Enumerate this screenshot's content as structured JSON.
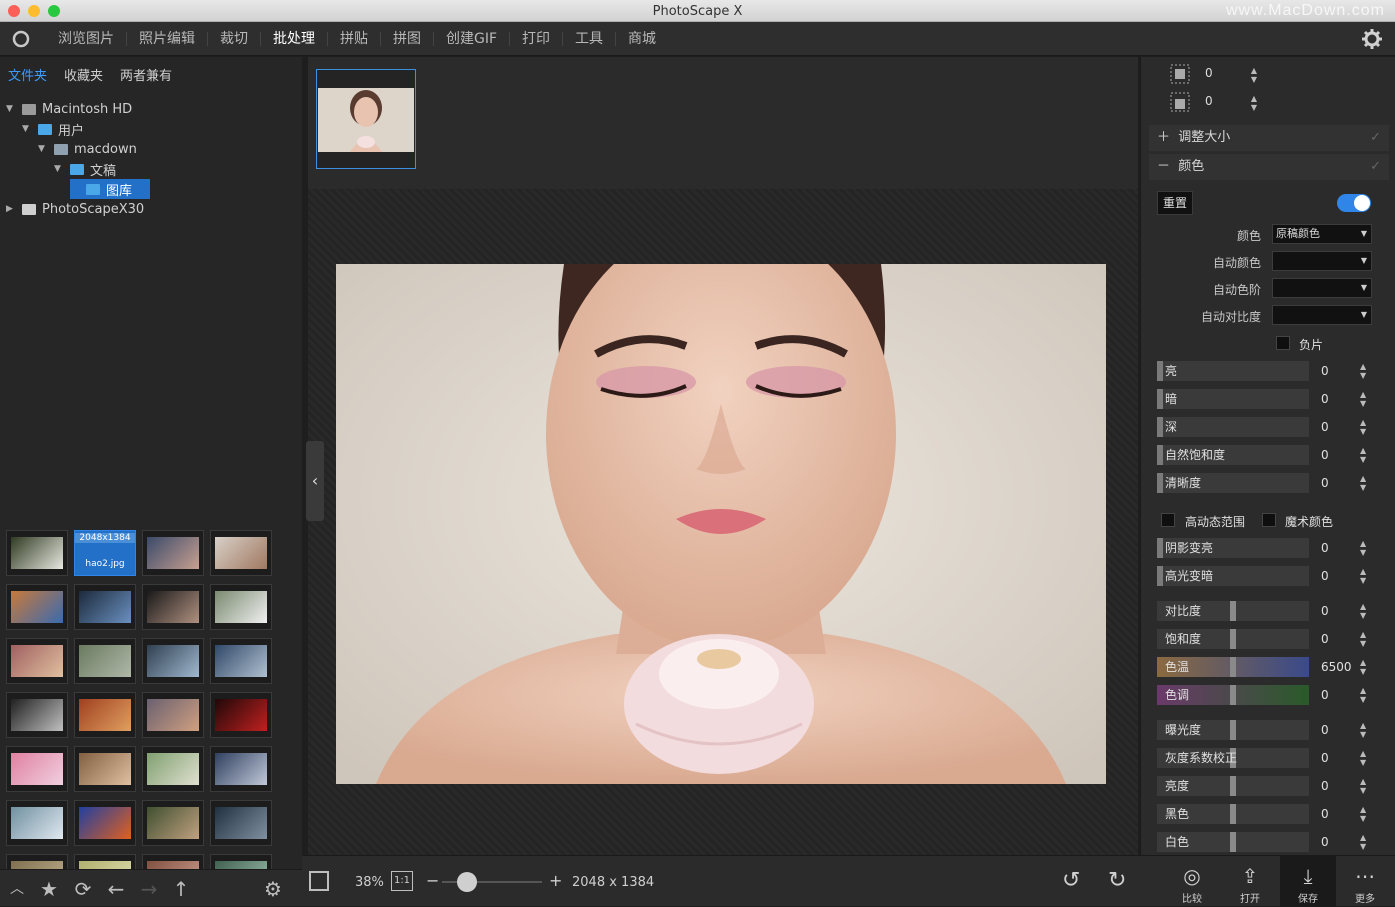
{
  "window": {
    "title": "PhotoScape X",
    "watermark": "www.MacDown.com"
  },
  "menu": {
    "items": [
      "浏览图片",
      "照片编辑",
      "裁切",
      "批处理",
      "拼贴",
      "拼图",
      "创建GIF",
      "打印",
      "工具",
      "商城"
    ],
    "active_index": 3
  },
  "sidebar": {
    "tabs": [
      "文件夹",
      "收藏夹",
      "两者兼有"
    ],
    "tree": [
      {
        "label": "Macintosh HD",
        "level": 0,
        "expanded": true,
        "icon": "hdd-icon"
      },
      {
        "label": "用户",
        "level": 1,
        "expanded": true,
        "icon": "folder-icon"
      },
      {
        "label": "macdown",
        "level": 2,
        "expanded": true,
        "icon": "home-icon"
      },
      {
        "label": "文稿",
        "level": 3,
        "expanded": true,
        "icon": "folder-icon"
      },
      {
        "label": "图库",
        "level": 4,
        "selected": true,
        "icon": "folder-icon"
      },
      {
        "label": "PhotoScapeX30",
        "level": 0,
        "expanded": false,
        "icon": "disk-icon"
      }
    ],
    "selected_thumb": {
      "dims": "2048x1384",
      "name": "hao2.jpg"
    }
  },
  "right": {
    "margin_values": [
      "0",
      "0"
    ],
    "sections": {
      "resize": "调整大小",
      "color": "颜色"
    },
    "reset_label": "重置",
    "color_toggle_on": true,
    "dropdowns": [
      {
        "label": "颜色",
        "value": "原稿颜色"
      },
      {
        "label": "自动颜色",
        "value": ""
      },
      {
        "label": "自动色阶",
        "value": ""
      },
      {
        "label": "自动对比度",
        "value": ""
      }
    ],
    "negative_label": "负片",
    "sliders_a": [
      {
        "label": "亮",
        "value": "0"
      },
      {
        "label": "暗",
        "value": "0"
      },
      {
        "label": "深",
        "value": "0"
      },
      {
        "label": "自然饱和度",
        "value": "0"
      },
      {
        "label": "清晰度",
        "value": "0"
      }
    ],
    "checks": [
      "高动态范围",
      "魔术颜色"
    ],
    "sliders_b": [
      {
        "label": "阴影变亮",
        "value": "0"
      },
      {
        "label": "高光变暗",
        "value": "0"
      }
    ],
    "sliders_c": [
      {
        "label": "对比度",
        "value": "0"
      },
      {
        "label": "饱和度",
        "value": "0"
      },
      {
        "label": "色温",
        "value": "6500"
      },
      {
        "label": "色调",
        "value": "0"
      }
    ],
    "sliders_d": [
      {
        "label": "曝光度",
        "value": "0"
      },
      {
        "label": "灰度系数校正",
        "value": "0"
      },
      {
        "label": "亮度",
        "value": "0"
      },
      {
        "label": "黑色",
        "value": "0"
      },
      {
        "label": "白色",
        "value": "0"
      }
    ]
  },
  "bottom": {
    "zoom": "38%",
    "one_to_one": "1:1",
    "zoom_level": 0.25,
    "dimensions": "2048 x 1384",
    "buttons": [
      "比较",
      "打开",
      "保存",
      "更多"
    ]
  },
  "colors": {
    "accent": "#2f86e8",
    "selection": "#2370c8",
    "panel": "#2b2b2b"
  }
}
